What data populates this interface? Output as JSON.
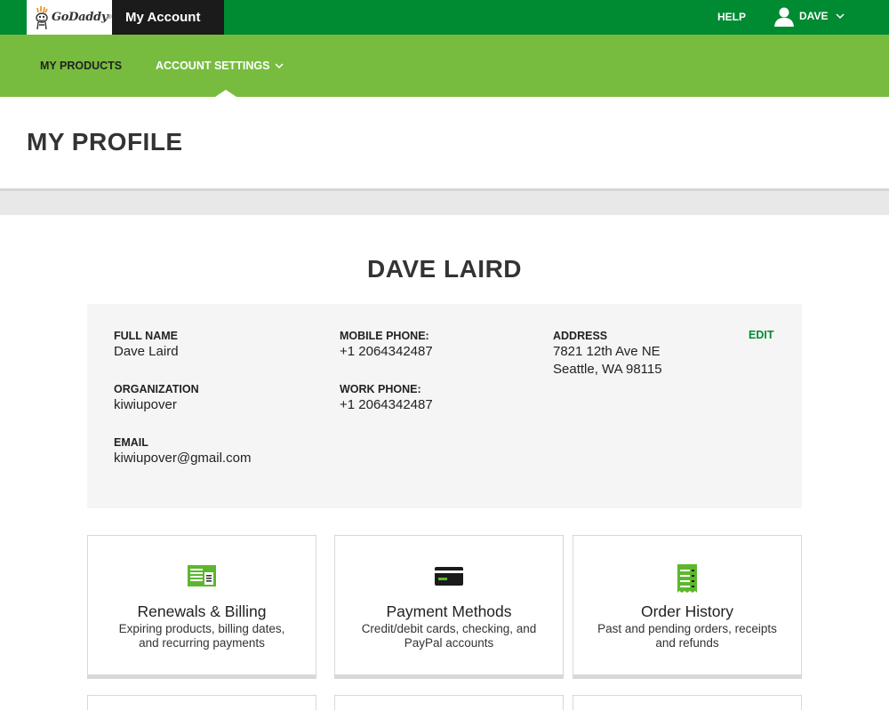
{
  "topbar": {
    "logo_text": "GoDaddy",
    "logo_reg": "®",
    "app_title": "My Account",
    "help_label": "HELP",
    "user_label": "DAVE"
  },
  "subnav": {
    "products_label": "MY PRODUCTS",
    "settings_label": "ACCOUNT SETTINGS"
  },
  "page": {
    "title": "MY PROFILE"
  },
  "profile": {
    "name": "DAVE LAIRD",
    "full_name_label": "FULL NAME",
    "full_name": "Dave Laird",
    "organization_label": "ORGANIZATION",
    "organization": "kiwiupover",
    "email_label": "EMAIL",
    "email": "kiwiupover@gmail.com",
    "mobile_label": "MOBILE PHONE:",
    "mobile": "+1 2064342487",
    "work_label": "WORK PHONE:",
    "work": "+1 2064342487",
    "address_label": "ADDRESS",
    "address_line1": "7821 12th Ave NE",
    "address_line2": "Seattle, WA 98115",
    "edit_label": "EDIT"
  },
  "cards": [
    {
      "title": "Renewals & Billing",
      "desc_line1": "Expiring products, billing dates,",
      "desc_line2": "and recurring payments",
      "icon": "billing-icon"
    },
    {
      "title": "Payment Methods",
      "desc_line1": "Credit/debit cards, checking, and",
      "desc_line2": "PayPal accounts",
      "icon": "credit-card-icon"
    },
    {
      "title": "Order History",
      "desc_line1": "Past and pending orders, receipts",
      "desc_line2": "and refunds",
      "icon": "receipt-icon"
    }
  ],
  "colors": {
    "brand_green_dark": "#008a32",
    "brand_green_light": "#77bc3f",
    "icon_green": "#5cb72d"
  }
}
